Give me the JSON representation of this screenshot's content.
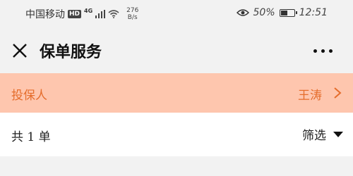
{
  "status_bar": {
    "carrier": "中国移动",
    "hd_badge": "HD",
    "network": "4G",
    "speed_value": "276",
    "speed_unit": "B/s",
    "battery_percent": "50%",
    "battery_level": 0.5,
    "time": "12:51",
    "icons": [
      "signal-icon",
      "wifi-icon",
      "eye-icon",
      "battery-icon"
    ]
  },
  "nav": {
    "title": "保单服务",
    "close_icon": "close-icon",
    "more_icon": "more-icon"
  },
  "policy_holder": {
    "label": "投保人",
    "value": "王涛",
    "icon": "chevron-right-icon"
  },
  "summary": {
    "count_label": "共 1 单",
    "filter_label": "筛选",
    "filter_icon": "caret-down-icon"
  },
  "colors": {
    "accent": "#e56d2c",
    "highlight_bg": "#fec6ae",
    "page_bg": "#f2f2f2"
  }
}
